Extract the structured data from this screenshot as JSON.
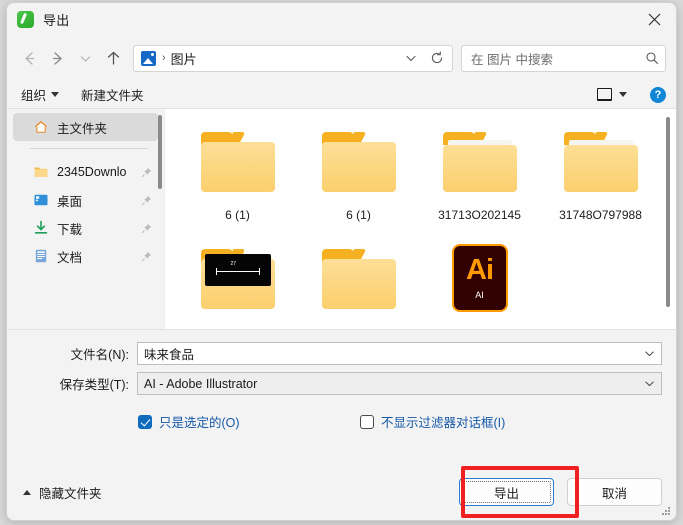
{
  "window": {
    "title": "导出",
    "app_icon": "coreldraw-green-icon",
    "close_label": "✕",
    "accent_blue": "#2b7ccc",
    "highlight_red": "#f02020"
  },
  "nav": {
    "back_icon": "arrow-left-icon",
    "forward_icon": "arrow-right-icon",
    "recent_icon": "chevron-down-icon",
    "up_icon": "arrow-up-icon",
    "breadcrumb": {
      "folder_icon": "pictures-icon",
      "separator": "›",
      "current": "图片",
      "dropdown_icon": "chevron-down-icon",
      "refresh_icon": "refresh-icon"
    },
    "search": {
      "placeholder": "在 图片 中搜索",
      "icon": "search-icon"
    }
  },
  "command_bar": {
    "organize": "组织",
    "new_folder": "新建文件夹",
    "view_icon": "layout-view-icon",
    "view_dropdown_icon": "chevron-down-icon",
    "help_icon": "help-question-icon",
    "help_label": "?"
  },
  "sidebar": {
    "scrollbar": "vertical-scrollbar",
    "items": [
      {
        "label": "主文件夹",
        "icon": "home-icon",
        "selected": true,
        "pinned": false
      },
      {
        "label": "2345Downlo",
        "icon": "folder-icon",
        "selected": false,
        "pinned": true
      },
      {
        "label": "桌面",
        "icon": "desktop-icon",
        "selected": false,
        "pinned": true
      },
      {
        "label": "下载",
        "icon": "download-icon",
        "selected": false,
        "pinned": true
      },
      {
        "label": "文档",
        "icon": "document-icon",
        "selected": false,
        "pinned": true
      }
    ]
  },
  "files": {
    "scrollbar": "vertical-scrollbar",
    "items": [
      {
        "label": "6 (1)",
        "kind": "folder"
      },
      {
        "label": "6 (1)",
        "kind": "folder"
      },
      {
        "label": "31713O202145",
        "kind": "folder-open"
      },
      {
        "label": "31748O797988",
        "kind": "folder-open"
      },
      {
        "label": "",
        "kind": "folder-preview",
        "preview_text": "27"
      },
      {
        "label": "",
        "kind": "folder"
      },
      {
        "label": "",
        "kind": "ai-file",
        "badge": "Ai",
        "sub": "AI"
      }
    ]
  },
  "form": {
    "filename": {
      "label": "文件名(N):",
      "value": "味来食品",
      "dropdown_icon": "chevron-down-icon"
    },
    "filetype": {
      "label": "保存类型(T):",
      "value": "AI - Adobe Illustrator",
      "dropdown_icon": "chevron-down-icon"
    }
  },
  "options": [
    {
      "label": "只是选定的(O)",
      "checked": true
    },
    {
      "label": "不显示过滤器对话框(I)",
      "checked": false
    }
  ],
  "footer": {
    "hide_folders": "隐藏文件夹",
    "hide_folders_icon": "chevron-up-icon",
    "export_button": "导出",
    "cancel_button": "取消",
    "resize_grip": "resize-grip-icon"
  }
}
